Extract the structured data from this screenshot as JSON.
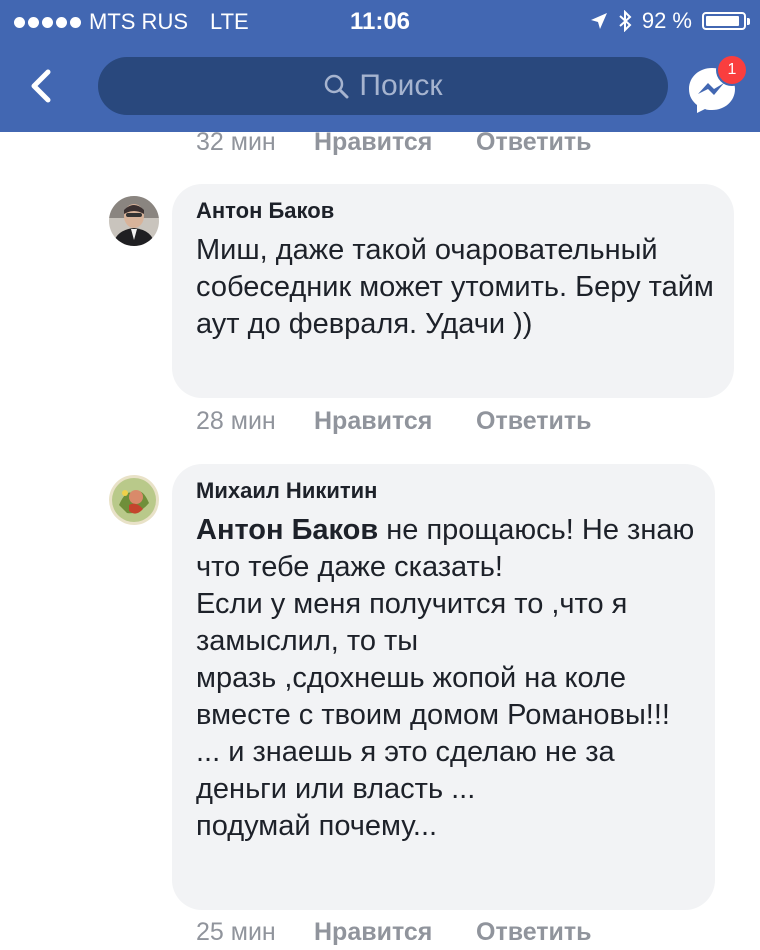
{
  "status_bar": {
    "carrier": "MTS RUS",
    "network": "LTE",
    "time": "11:06",
    "battery": "92 %",
    "battery_level": 0.92
  },
  "nav": {
    "search_placeholder": "Поиск",
    "messenger_badge": "1"
  },
  "top_meta": {
    "time": "32 мин",
    "like": "Нравится",
    "reply": "Ответить"
  },
  "comments": [
    {
      "author": "Антон Баков",
      "text": "Миш, даже такой очаровательный собеседник может утомить. Беру тайм аут до февраля. Удачи ))",
      "time": "28 мин",
      "like": "Нравится",
      "reply": "Ответить"
    },
    {
      "author": "Михаил Никитин",
      "mention": "Антон Баков",
      "text": " не прощаюсь!  Не знаю что тебе даже сказать!\nЕсли у меня получится то ,что я замыслил, то ты\nмразь ,сдохнешь жопой на коле вместе с твоим домом Романовы!!!\n... и знаешь я это сделаю не за деньги или власть ...\nподумай почему...",
      "time": "25 мин",
      "like": "Нравится",
      "reply": "Ответить"
    }
  ],
  "colors": {
    "header": "#4267b2",
    "search_bg": "#29487d",
    "bubble": "#f2f3f5",
    "badge": "#fa3e3e",
    "meta": "#90949c"
  }
}
